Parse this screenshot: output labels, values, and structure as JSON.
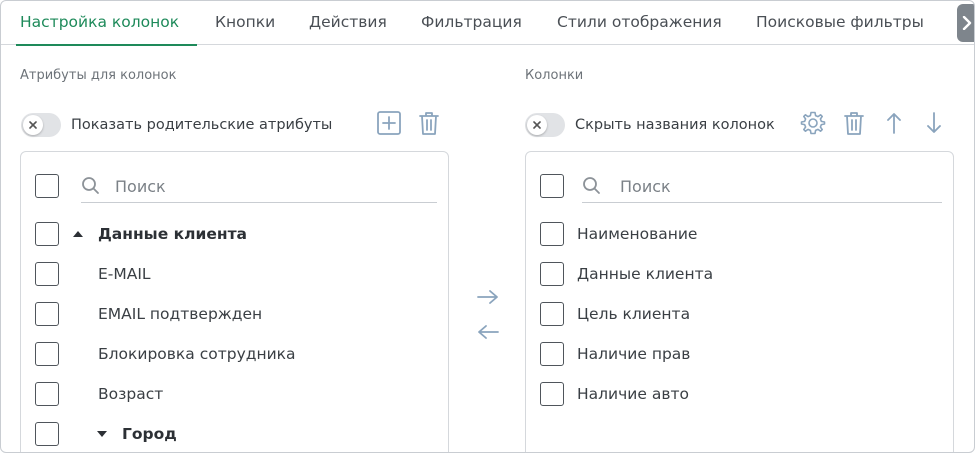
{
  "tabs": [
    {
      "label": "Настройка колонок",
      "active": true
    },
    {
      "label": "Кнопки",
      "active": false
    },
    {
      "label": "Действия",
      "active": false
    },
    {
      "label": "Фильтрация",
      "active": false
    },
    {
      "label": "Стили отображения",
      "active": false
    },
    {
      "label": "Поисковые фильтры",
      "active": false
    }
  ],
  "left": {
    "section_title": "Атрибуты для колонок",
    "toggle_label": "Показать родительские атрибуты",
    "search_placeholder": "Поиск",
    "items": [
      {
        "label": "Данные клиента",
        "group": true,
        "expanded": true
      },
      {
        "label": "E-MAIL"
      },
      {
        "label": "EMAIL подтвержден"
      },
      {
        "label": "Блокировка сотрудника"
      },
      {
        "label": "Возраст"
      },
      {
        "label": "Город",
        "group": true,
        "expanded": false
      }
    ]
  },
  "right": {
    "section_title": "Колонки",
    "toggle_label": "Скрыть названия колонок",
    "search_placeholder": "Поиск",
    "items": [
      {
        "label": "Наименование"
      },
      {
        "label": "Данные клиента"
      },
      {
        "label": "Цель клиента"
      },
      {
        "label": "Наличие прав"
      },
      {
        "label": "Наличие авто"
      }
    ]
  },
  "colors": {
    "accent": "#1e8a5a",
    "icon": "#8aa4bd",
    "text": "#3a3f44"
  }
}
